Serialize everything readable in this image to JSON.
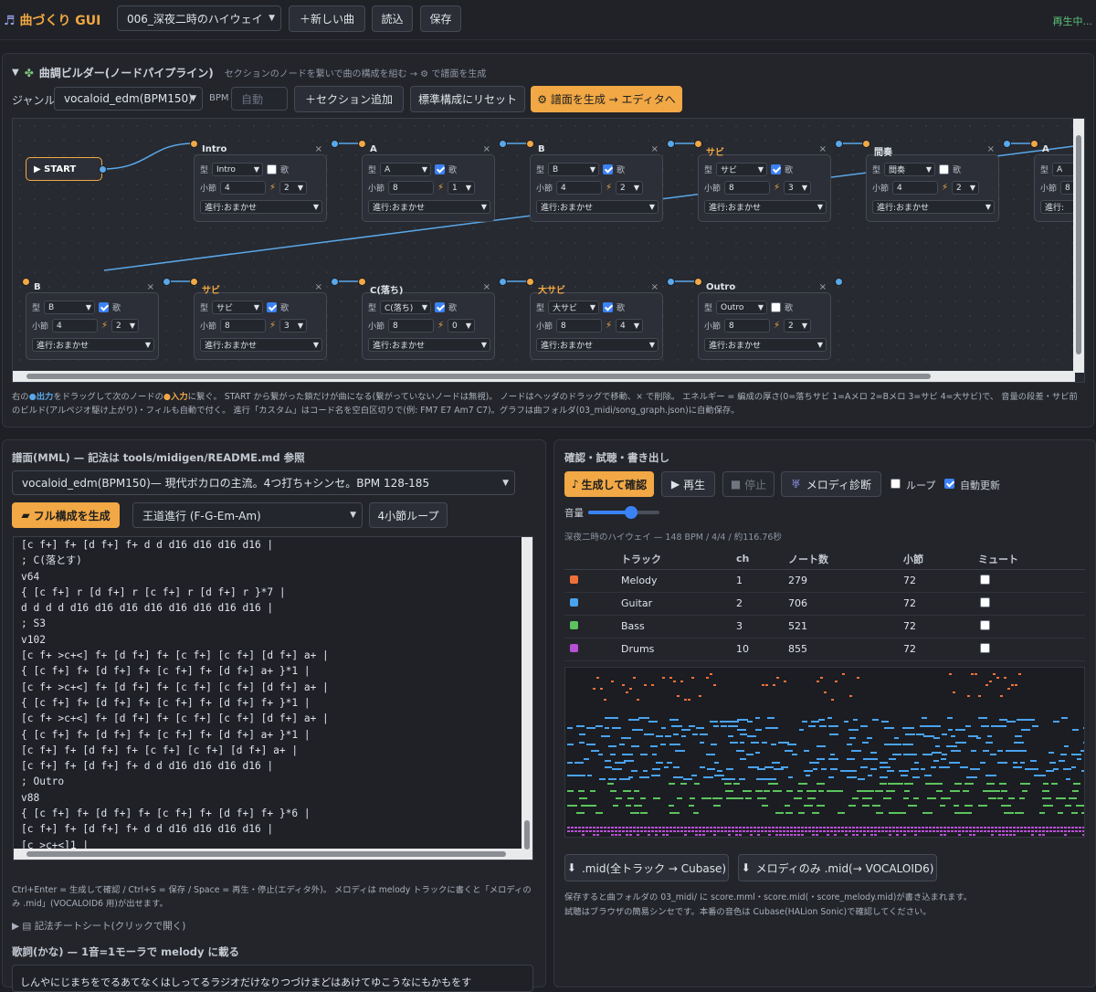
{
  "app": {
    "title": "曲づくり GUI",
    "status": "再生中..."
  },
  "topbar": {
    "song_select": "006_深夜二時のハイウェイ",
    "new_song": "＋新しい曲",
    "load": "読込",
    "save": "保存"
  },
  "builder": {
    "title": "曲調ビルダー(ノードパイプライン)",
    "hint": "セクションのノードを繋いで曲の構成を組む → ⚙ で譜面を生成",
    "genre_label": "ジャンル",
    "genre": "vocaloid_edm(BPM150)",
    "bpm_label": "BPM",
    "bpm_placeholder": "自動",
    "add_section": "＋セクション追加",
    "reset": "標準構成にリセット",
    "generate": "⚙ 譜面を生成 → エディタへ",
    "start_label": "▶ START",
    "field_type": "型",
    "field_bars": "小節",
    "field_vocal": "歌",
    "progress_prefix": "進行: ",
    "nodes": [
      {
        "name": "Intro",
        "type": "Intro",
        "bars": "4",
        "vocal": false,
        "energy": "2",
        "progress": "おまかせ"
      },
      {
        "name": "A",
        "type": "A",
        "bars": "8",
        "vocal": true,
        "energy": "1",
        "progress": "おまかせ"
      },
      {
        "name": "B",
        "type": "B",
        "bars": "4",
        "vocal": true,
        "energy": "2",
        "progress": "おまかせ"
      },
      {
        "name": "サビ",
        "type": "サビ",
        "bars": "8",
        "vocal": true,
        "energy": "3",
        "progress": "おまかせ"
      },
      {
        "name": "間奏",
        "type": "間奏",
        "bars": "4",
        "vocal": false,
        "energy": "2",
        "progress": "おまかせ"
      },
      {
        "name": "A",
        "type": "A",
        "bars": "8",
        "vocal": true,
        "energy": "",
        "progress": ""
      },
      {
        "name": "B",
        "type": "B",
        "bars": "4",
        "vocal": true,
        "energy": "2",
        "progress": "おまかせ"
      },
      {
        "name": "サビ",
        "type": "サビ",
        "bars": "8",
        "vocal": true,
        "energy": "3",
        "progress": "おまかせ"
      },
      {
        "name": "C(落ち)",
        "type": "C(落ち)",
        "bars": "8",
        "vocal": true,
        "energy": "0",
        "progress": "おまかせ"
      },
      {
        "name": "大サビ",
        "type": "大サビ",
        "bars": "8",
        "vocal": true,
        "energy": "4",
        "progress": "おまかせ"
      },
      {
        "name": "Outro",
        "type": "Outro",
        "bars": "8",
        "vocal": false,
        "energy": "2",
        "progress": "おまかせ"
      }
    ],
    "help_1a": "右の",
    "help_1b": "●出力",
    "help_1c": "をドラッグして次のノードの",
    "help_1d": "●入力",
    "help_1e": "に繋ぐ。 START から繋がった鎖だけが曲になる(繋がっていないノードは無視)。 ノードはヘッダのドラッグで移動、× で削除。 エネルギー = 編成の厚さ(0=落ちサビ 1=Aメロ 2=Bメロ 3=サビ 4=大サビ)で、 音量の段差・サビ前のビルド(アルペジオ駆け上がり)・フィルも自動で付く。 進行「カスタム」はコード名を空白区切りで(例: FM7 E7 Am7 C7)。グラフは曲フォルダ(03_midi/song_graph.json)に自動保存。"
  },
  "score": {
    "title": "譜面(MML) — 記法は tools/midigen/README.md 参照",
    "preset": "vocaloid_edm(BPM150)— 現代ボカロの主流。4つ打ち+シンセ。BPM 128-185",
    "full_gen": "フル構成を生成",
    "progression": "王道進行 (F-G-Em-Am)",
    "loop4": "4小節ループ",
    "lines": [
      "[c f+] f+ [d f+] f+ d d d16 d16 d16 d16 |",
      "; C(落とす)",
      "v64",
      "{ [c f+] r [d f+] r [c f+] r [d f+] r }*7 |",
      "d d d d d16 d16 d16 d16 d16 d16 d16 d16 |",
      "; S3",
      "v102",
      "[c f+ >c+<] f+ [d f+] f+ [c f+] [c f+] [d f+] a+ |",
      "{ [c f+] f+ [d f+] f+ [c f+] f+ [d f+] a+ }*1 |",
      "[c f+ >c+<] f+ [d f+] f+ [c f+] [c f+] [d f+] a+ |",
      "{ [c f+] f+ [d f+] f+ [c f+] f+ [d f+] f+ }*1 |",
      "[c f+ >c+<] f+ [d f+] f+ [c f+] [c f+] [d f+] a+ |",
      "{ [c f+] f+ [d f+] f+ [c f+] f+ [d f+] a+ }*1 |",
      "[c f+] f+ [d f+] f+ [c f+] [c f+] [d f+] a+ |",
      "[c f+] f+ [d f+] f+ d d d16 d16 d16 d16 |",
      "; Outro",
      "v88",
      "{ [c f+] f+ [d f+] f+ [c f+] f+ [d f+] f+ }*6 |",
      "[c f+] f+ [d f+] f+ d d d16 d16 d16 d16 |",
      "[c >c+<]1 |"
    ],
    "shortcuts": "Ctrl+Enter = 生成して確認 / Ctrl+S = 保存 / Space = 再生・停止(エディタ外)。 メロディは melody トラックに書くと「メロディのみ .mid」(VOCALOID6 用)が出せます。",
    "cheatsheet": "記法チートシート(クリックで開く)",
    "lyrics_title": "歌詞(かな) — 1音=1モーラで melody に載る",
    "lyrics": "しんやにじまちをでるあてなくはしってるラジオだけなりつづけまどはあけてゆこうなにもかもをす"
  },
  "check": {
    "title": "確認・試聴・書き出し",
    "gen_check": "生成して確認",
    "play": "再生",
    "stop": "停止",
    "diagnose": "メロディ診断",
    "loop": "ループ",
    "autoupdate": "自動更新",
    "volume": "音量",
    "volume_value": 0.6,
    "song_info": "深夜二時のハイウェイ — 148 BPM / 4/4 / 約116.76秒",
    "headers": [
      "トラック",
      "ch",
      "ノート数",
      "小節",
      "ミュート"
    ],
    "tracks": [
      {
        "name": "Melody",
        "ch": "1",
        "notes": "279",
        "bars": "72",
        "color": "#f0703a"
      },
      {
        "name": "Guitar",
        "ch": "2",
        "notes": "706",
        "bars": "72",
        "color": "#4aa3f0"
      },
      {
        "name": "Bass",
        "ch": "3",
        "notes": "521",
        "bars": "72",
        "color": "#5cc45e"
      },
      {
        "name": "Drums",
        "ch": "10",
        "notes": "855",
        "bars": "72",
        "color": "#b94fd6"
      }
    ],
    "export_all": ".mid(全トラック → Cubase)",
    "export_melody": "メロディのみ .mid(→ VOCALOID6)",
    "note1": "保存すると曲フォルダの 03_midi/ に score.mml・score.mid(・score_melody.mid)が書き込まれます。",
    "note2": "試聴はブラウザの簡易シンセです。本番の音色は Cubase(HALion Sonic)で確認してください。"
  }
}
